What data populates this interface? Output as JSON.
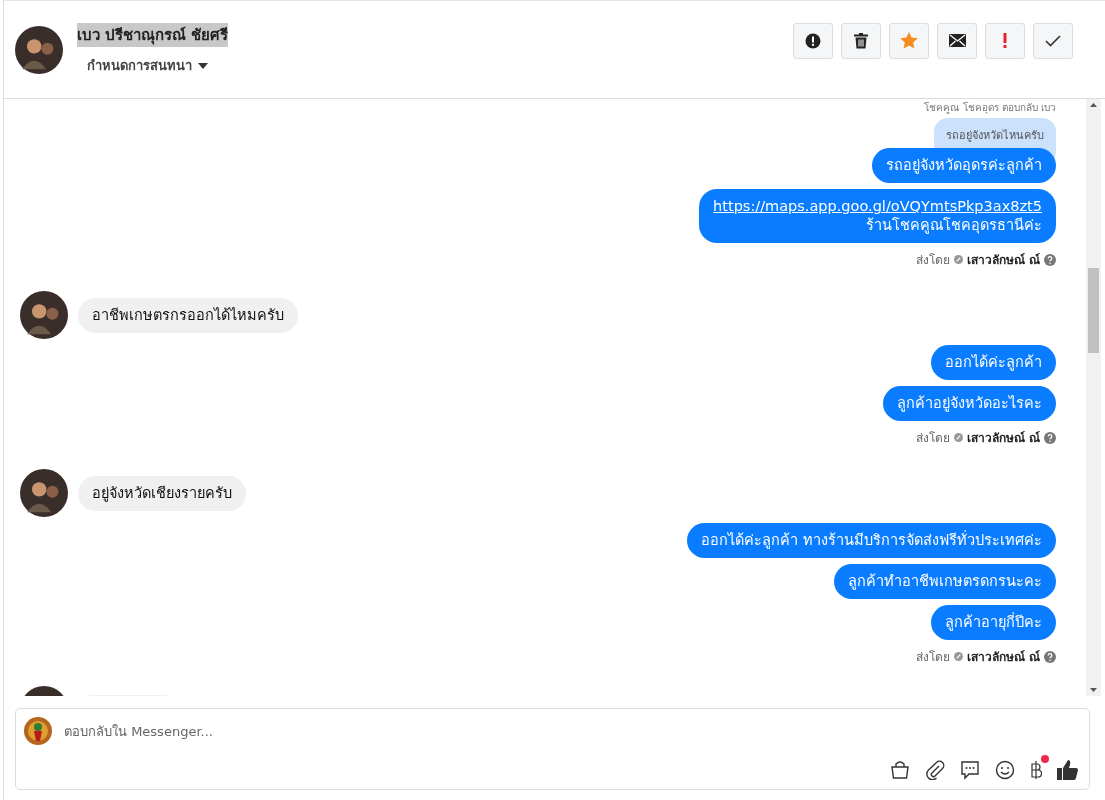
{
  "header": {
    "name": "เบว ปรีชาณุกรณ์ ชัยศรี",
    "name_selected": true,
    "assign_label": "กำหนดการสนทนา"
  },
  "actions": [
    {
      "kind": "alert"
    },
    {
      "kind": "trash"
    },
    {
      "kind": "star",
      "on": true
    },
    {
      "kind": "mail"
    },
    {
      "kind": "important"
    },
    {
      "kind": "check"
    }
  ],
  "messages": [
    {
      "kind": "reply_note",
      "text": "โชคคูณ โชคอุดร ตอบกลับ เบว"
    },
    {
      "kind": "quoted",
      "text": "รถอยู่จังหวัดไหนครับ"
    },
    {
      "kind": "outgoing",
      "lines": [
        {
          "kind": "text",
          "text": "รถอยู่จังหวัดอุดรค่ะลูกค้า"
        }
      ]
    },
    {
      "kind": "outgoing",
      "lines": [
        {
          "kind": "link",
          "text": "https://maps.app.goo.gl/oVQYmtsPkp3ax8zt5"
        },
        {
          "kind": "text",
          "text": "ร้านโชคคูณโชคอุดรธานีค่ะ"
        }
      ]
    },
    {
      "kind": "sent_by",
      "label": "ส่งโดย",
      "agent": "เสาวลักษณ์ ณ์"
    },
    {
      "kind": "incoming",
      "lines": [
        {
          "kind": "text",
          "text": "อาชีพเกษตรกรออกได้ไหมครับ"
        }
      ]
    },
    {
      "kind": "outgoing",
      "lines": [
        {
          "kind": "text",
          "text": "ออกได้ค่ะลูกค้า"
        }
      ]
    },
    {
      "kind": "outgoing",
      "lines": [
        {
          "kind": "text",
          "text": "ลูกค้าอยู่จังหวัดอะไรคะ"
        }
      ]
    },
    {
      "kind": "sent_by",
      "label": "ส่งโดย",
      "agent": "เสาวลักษณ์ ณ์"
    },
    {
      "kind": "incoming",
      "lines": [
        {
          "kind": "text",
          "text": "อยู่จังหวัดเชียงรายครับ"
        }
      ]
    },
    {
      "kind": "outgoing",
      "lines": [
        {
          "kind": "text",
          "text": "ออกได้ค่ะลูกค้า ทางร้านมีบริการจัดส่งฟรีทั่วประเทศค่ะ"
        }
      ]
    },
    {
      "kind": "outgoing",
      "lines": [
        {
          "kind": "text",
          "text": "ลูกค้าทำอาชีพเกษตรดกรนะคะ"
        }
      ]
    },
    {
      "kind": "outgoing",
      "lines": [
        {
          "kind": "text",
          "text": "ลูกค้าอายุกี่ปีคะ"
        }
      ]
    },
    {
      "kind": "sent_by",
      "label": "ส่งโดย",
      "agent": "เสาวลักษณ์ ณ์"
    },
    {
      "kind": "partial"
    }
  ],
  "composer": {
    "placeholder": "ตอบกลับใน Messenger...",
    "tools": [
      {
        "kind": "bag"
      },
      {
        "kind": "clip"
      },
      {
        "kind": "chat"
      },
      {
        "kind": "emoji"
      },
      {
        "kind": "baht",
        "badge": true
      },
      {
        "kind": "like"
      }
    ]
  }
}
